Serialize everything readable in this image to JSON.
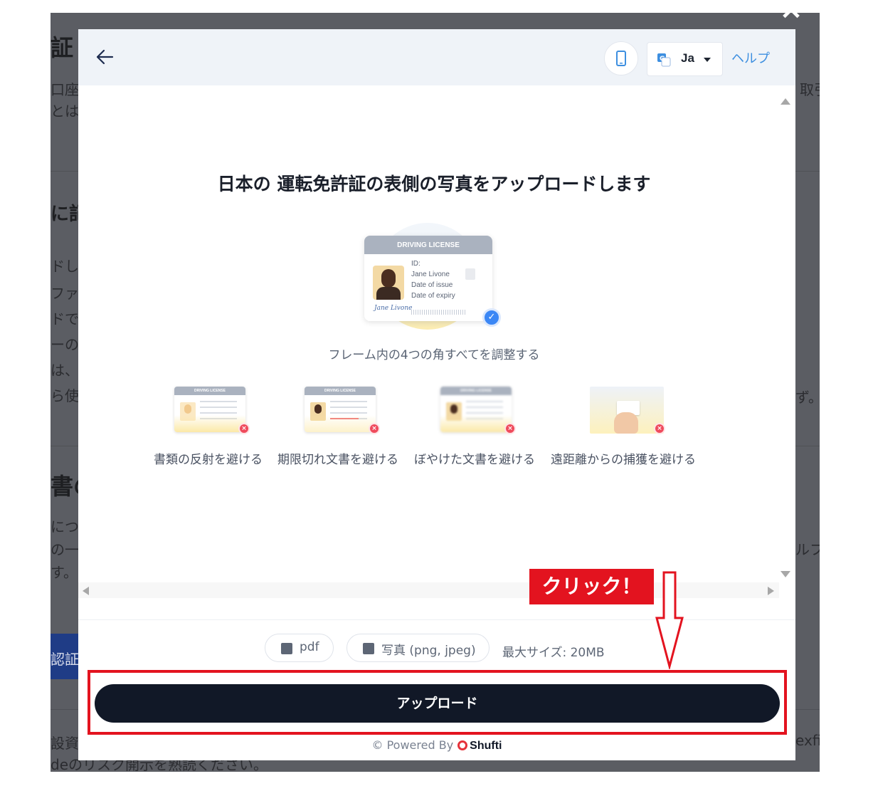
{
  "background_page": {
    "fragments": [
      "証",
      "口座開",
      "とは",
      "取引",
      "に記",
      "ドし",
      "ファ",
      "ドで",
      "ーの",
      "は、",
      "ら使い",
      "ず。",
      "書の",
      "につ",
      "の一",
      "す。",
      "ルフ",
      "認証",
      "設資",
      "deのリスク開示を熟読ください。",
      "exfi"
    ]
  },
  "close_icon": "close-icon",
  "header": {
    "back_icon": "arrow-left-icon",
    "device_icon": "smartphone-icon",
    "language": "Ja",
    "help": "ヘルプ"
  },
  "main": {
    "title": "日本の 運転免許証の表側の写真をアップロードします",
    "hero_card": {
      "header": "DRIVING LICENSE",
      "id_label": "ID:",
      "name": "Jane Livone",
      "issue_label": "Date of issue",
      "expiry_label": "Date of expiry",
      "signature": "Jane Livone"
    },
    "hero_caption": "フレーム内の4つの角すべてを調整する",
    "tips": [
      {
        "label": "書類の反射を避ける",
        "card_header": "DRIVING LICENSE"
      },
      {
        "label": "期限切れ文書を避ける",
        "card_header": "DRIVING LICENSE"
      },
      {
        "label": "ぼやけた文書を避ける",
        "card_header": "DRIVING LICENSE"
      },
      {
        "label": "遠距離からの捕獲を避ける",
        "card_header": ""
      }
    ]
  },
  "footer": {
    "formats": [
      "pdf",
      "写真 (png, jpeg)"
    ],
    "max_size": "最大サイズ: 20MB",
    "upload_button": "アップロード",
    "powered_by": "© Powered By",
    "brand": "Shufti"
  },
  "annotation": {
    "callout": "クリック！",
    "color": "#e3131f"
  },
  "colors": {
    "primary_button": "#111827",
    "link": "#3d8fe0",
    "header_bg": "#eff3f8",
    "error": "#ef4b5c",
    "success": "#3b87f5"
  }
}
